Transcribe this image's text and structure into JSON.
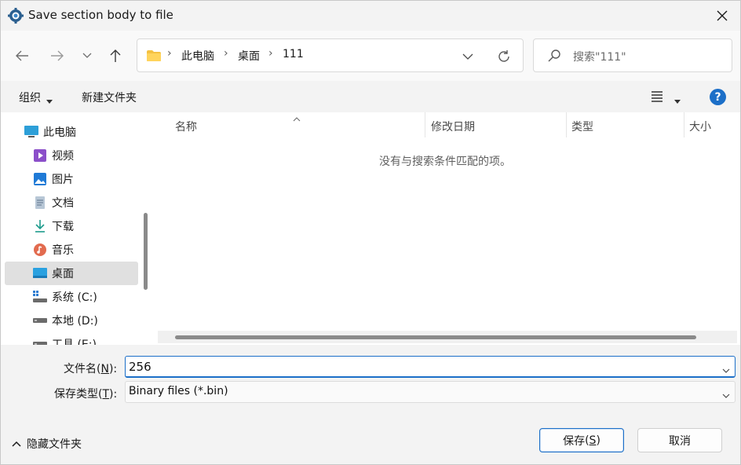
{
  "window": {
    "title": "Save section body to file",
    "accent_color": "#1c6fc8"
  },
  "nav": {
    "back_icon": "arrow-left-icon",
    "forward_icon": "arrow-right-icon",
    "recent_icon": "chevron-down-icon",
    "up_icon": "arrow-up-icon"
  },
  "address": {
    "breadcrumbs": [
      "此电脑",
      "桌面",
      "111"
    ]
  },
  "search": {
    "placeholder": "搜索\"111\""
  },
  "command_bar": {
    "organize": "组织",
    "new_folder": "新建文件夹"
  },
  "sidebar": {
    "items": [
      {
        "label": "此电脑",
        "icon": "computer-icon"
      },
      {
        "label": "视频",
        "icon": "video-icon"
      },
      {
        "label": "图片",
        "icon": "pictures-icon"
      },
      {
        "label": "文档",
        "icon": "document-icon"
      },
      {
        "label": "下载",
        "icon": "download-icon"
      },
      {
        "label": "音乐",
        "icon": "music-icon"
      },
      {
        "label": "桌面",
        "icon": "desktop-icon",
        "selected": true
      },
      {
        "label": "系统 (C:)",
        "icon": "system-drive-icon"
      },
      {
        "label": "本地 (D:)",
        "icon": "drive-icon"
      },
      {
        "label": "工具 (E:)",
        "icon": "drive-icon"
      }
    ]
  },
  "filelist": {
    "columns": [
      "名称",
      "修改日期",
      "类型",
      "大小"
    ],
    "empty_message": "没有与搜索条件匹配的项。"
  },
  "form": {
    "filename_label": "文件名",
    "filename_key": "N",
    "filename_value": "256",
    "filetype_label": "保存类型",
    "filetype_key": "T",
    "filetype_value": "Binary files (*.bin)"
  },
  "footer": {
    "hide_folders": "隐藏文件夹",
    "save_label": "保存",
    "save_key": "S",
    "cancel_label": "取消"
  }
}
